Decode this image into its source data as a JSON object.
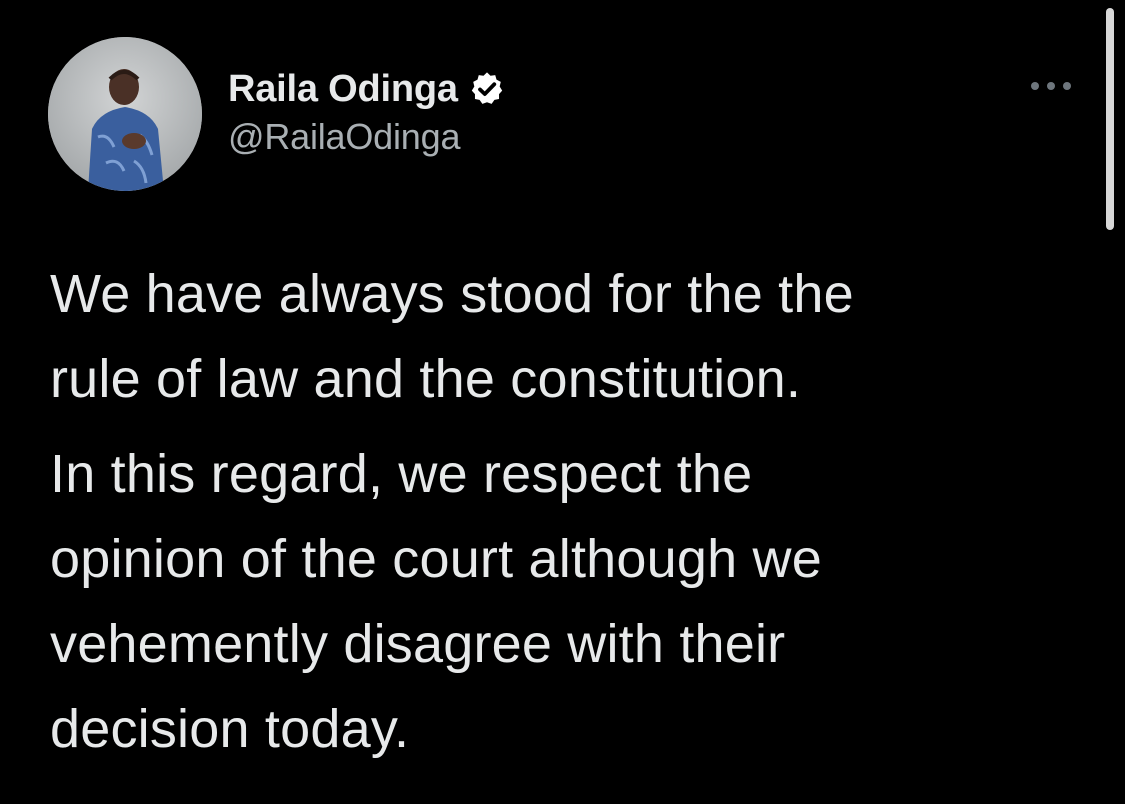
{
  "author": {
    "display_name": "Raila Odinga",
    "handle": "@RailaOdinga",
    "verified": true,
    "avatar_description": "profile photo"
  },
  "icons": {
    "verified": "verified-badge-icon",
    "more": "more-options-icon"
  },
  "tweet": {
    "paragraphs": [
      {
        "lines": [
          "We have always stood for the the",
          "rule of law and the constitution."
        ]
      },
      {
        "lines": [
          "In this regard, we respect the",
          "opinion of the court although we",
          "vehemently disagree with their",
          "decision today."
        ]
      }
    ]
  },
  "colors": {
    "background": "#000000",
    "text": "#e7e9ea",
    "secondary_text": "#a9afb3"
  }
}
